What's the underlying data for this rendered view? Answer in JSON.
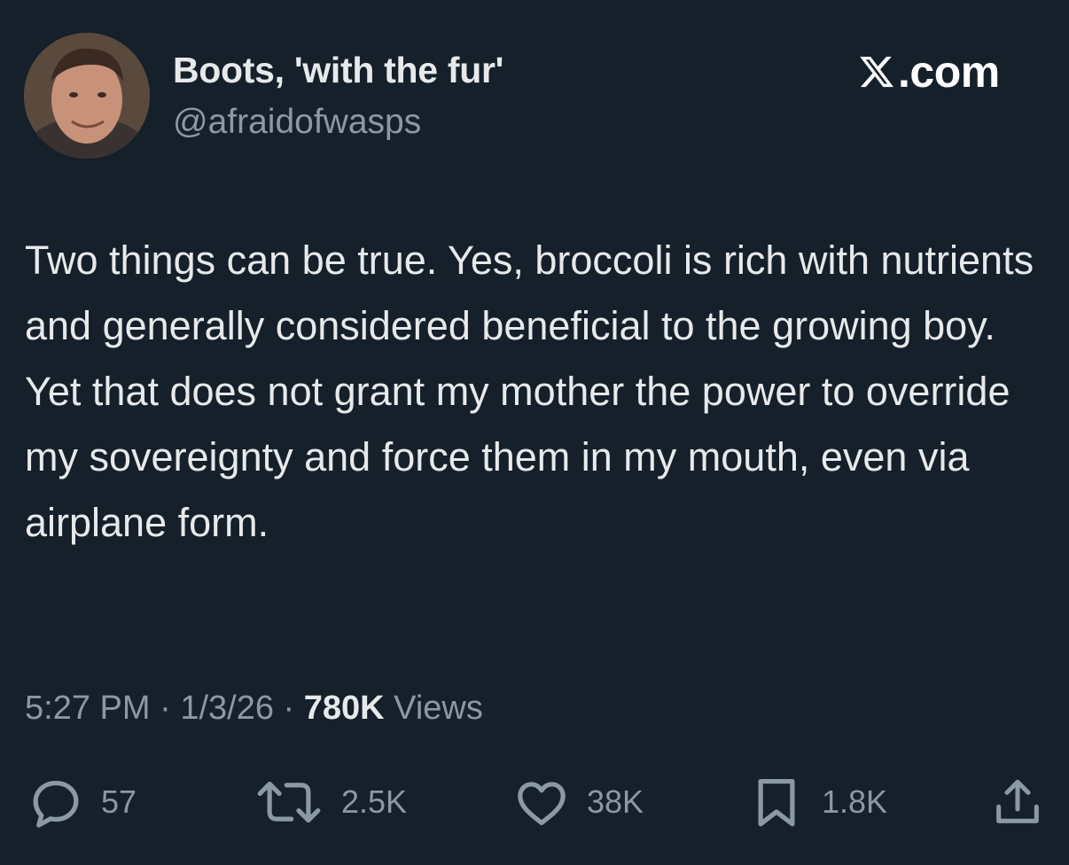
{
  "author": {
    "display_name": "Boots, 'with the fur'",
    "handle": "@afraidofwasps"
  },
  "brand": {
    "text": ".com",
    "icon": "x-logo-icon"
  },
  "tweet": {
    "text": "Two things can be true. Yes, broccoli is rich with nutrients and generally considered beneficial to the growing boy. Yet that does not grant my mother the power to override my sovereignty and force them in my mouth, even via airplane form."
  },
  "meta": {
    "time": "5:27 PM",
    "separator": "·",
    "date": "1/3/26",
    "views_count": "780K",
    "views_label": "Views"
  },
  "actions": {
    "reply": {
      "icon": "reply-icon",
      "count": "57"
    },
    "repost": {
      "icon": "repost-icon",
      "count": "2.5K"
    },
    "like": {
      "icon": "heart-icon",
      "count": "38K"
    },
    "bookmark": {
      "icon": "bookmark-icon",
      "count": "1.8K"
    },
    "share": {
      "icon": "share-icon"
    }
  },
  "colors": {
    "background": "#15202b",
    "text_primary": "#e7e9ea",
    "text_secondary": "#8b98a5"
  }
}
